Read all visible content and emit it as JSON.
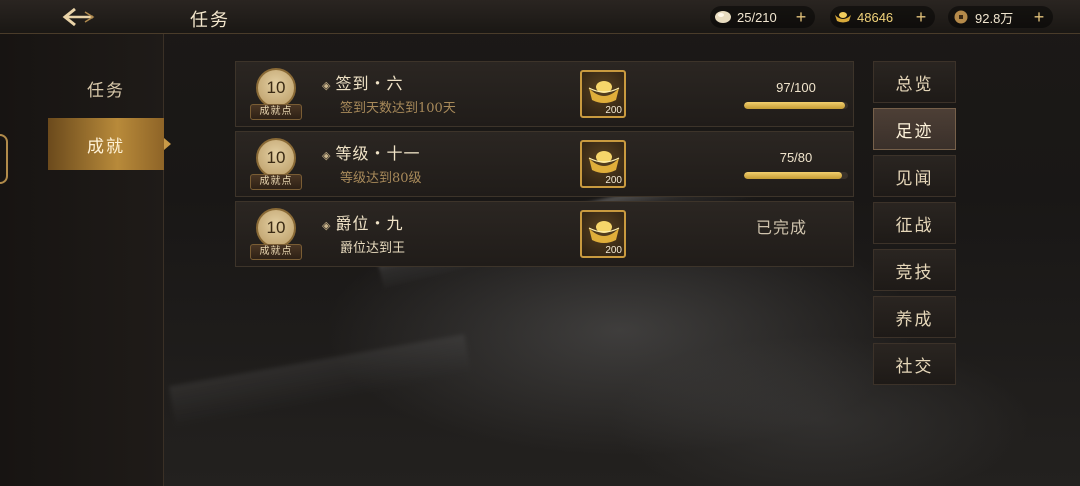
{
  "header": {
    "title": "任务"
  },
  "resources": [
    {
      "name": "stamina",
      "icon": "egg-icon",
      "value": "25/210"
    },
    {
      "name": "ingot",
      "icon": "gold-ingot-icon",
      "value": "48646"
    },
    {
      "name": "coin",
      "icon": "copper-coin-icon",
      "value": "92.8万"
    }
  ],
  "sidebar": {
    "items": [
      {
        "label": "任务",
        "active": false
      },
      {
        "label": "成就",
        "active": true
      }
    ]
  },
  "tasks": [
    {
      "points": "10",
      "points_label": "成就点",
      "title": "签到・六",
      "desc": "签到天数达到100天",
      "reward_qty": "200",
      "progress_text": "97/100",
      "progress": 0.97,
      "status": ""
    },
    {
      "points": "10",
      "points_label": "成就点",
      "title": "等级・十一",
      "desc": "等级达到80级",
      "reward_qty": "200",
      "progress_text": "75/80",
      "progress": 0.9375,
      "status": ""
    },
    {
      "points": "10",
      "points_label": "成就点",
      "title": "爵位・九",
      "desc": "爵位达到王",
      "reward_qty": "200",
      "progress_text": "",
      "progress": 1.0,
      "status": "已完成"
    }
  ],
  "categories": [
    {
      "label": "总览",
      "active": false
    },
    {
      "label": "足迹",
      "active": true
    },
    {
      "label": "见闻",
      "active": false
    },
    {
      "label": "征战",
      "active": false
    },
    {
      "label": "竞技",
      "active": false
    },
    {
      "label": "养成",
      "active": false
    },
    {
      "label": "社交",
      "active": false
    }
  ],
  "colors": {
    "accent_gold": "#c99a3f",
    "progress_fill": "#e3bd55"
  }
}
